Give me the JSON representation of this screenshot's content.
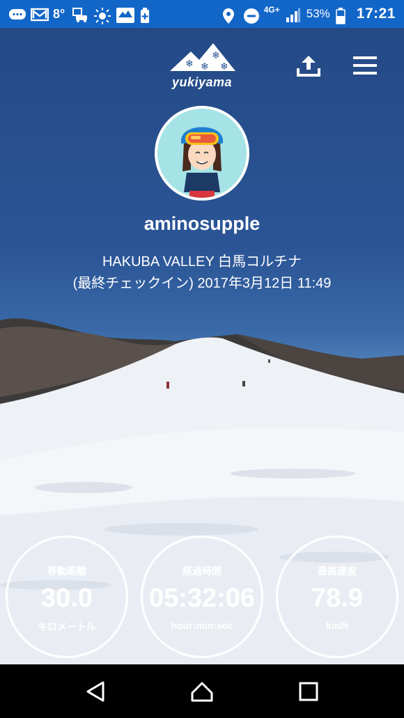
{
  "status_bar": {
    "temperature": "8°",
    "network": "4G+",
    "battery": "53%",
    "time": "17:21"
  },
  "app": {
    "logo_text": "yukiyama"
  },
  "profile": {
    "username": "aminosupple",
    "location": "HAKUBA VALLEY 白馬コルチナ",
    "last_checkin": "(最終チェックイン) 2017年3月12日 11:49"
  },
  "stats": [
    {
      "label": "移動距離",
      "value": "30.0",
      "unit": "キロメートル"
    },
    {
      "label": "経過時間",
      "value": "05:32:06",
      "unit": "hour:min:sec"
    },
    {
      "label": "最高速度",
      "value": "78.9",
      "unit": "km/h"
    }
  ],
  "icons": {
    "share": "share-upload-icon",
    "menu": "hamburger-menu-icon",
    "nav_back": "back-triangle-icon",
    "nav_home": "home-icon",
    "nav_recent": "recent-apps-icon"
  },
  "colors": {
    "status_bar": "#1266c8",
    "sky": "#2b5596"
  }
}
